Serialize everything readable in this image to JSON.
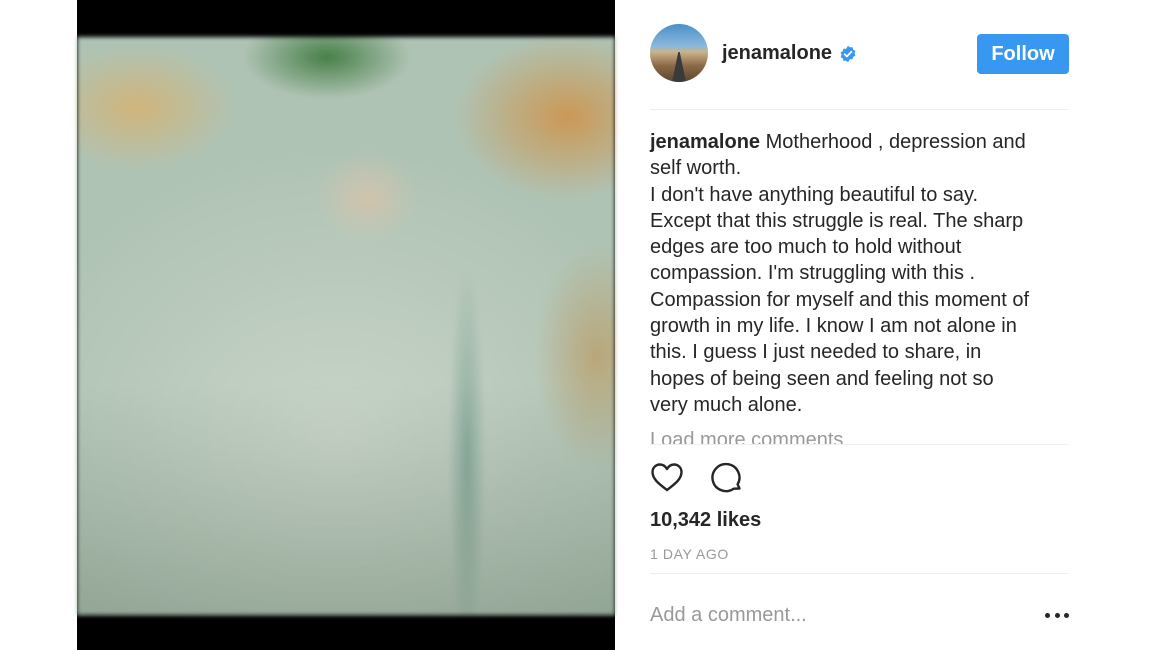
{
  "post": {
    "username": "jenamalone",
    "verified": true,
    "follow_label": "Follow",
    "caption_user": "jenamalone",
    "caption_lines": [
      "Motherhood , depression and",
      "self worth.",
      "I don't have anything beautiful to say.",
      "Except that this struggle is real. The sharp",
      "edges are too much to hold without",
      "compassion. I'm struggling with this .",
      "Compassion for myself and this moment of",
      "growth in my life. I know I am not alone in",
      "this. I guess I just needed to share, in",
      "hopes of being seen and feeling not so",
      "very much alone."
    ],
    "load_more": "Load more comments",
    "likes": "10,342 likes",
    "time": "1 DAY AGO",
    "comment_placeholder": "Add a comment..."
  },
  "icons": {
    "verified": "verified-badge-icon",
    "like": "heart-icon",
    "comment": "speech-bubble-icon",
    "more": "ellipsis-icon"
  },
  "colors": {
    "accent": "#3897f0",
    "text": "#262626",
    "muted": "#999999",
    "divider": "#efefef"
  }
}
